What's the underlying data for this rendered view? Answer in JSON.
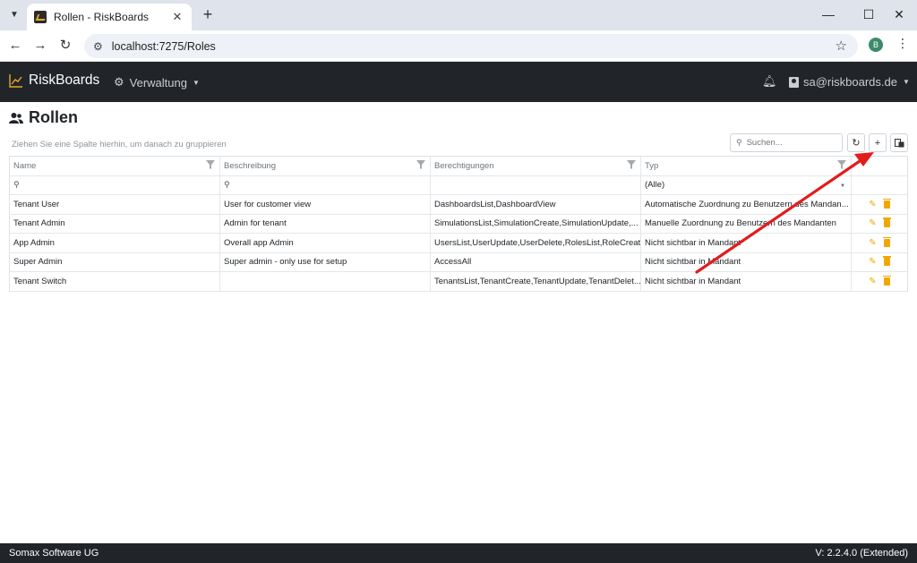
{
  "browser": {
    "tab_title": "Rollen - RiskBoards",
    "url": "localhost:7275/Roles",
    "profile_initial": "B",
    "icons": {
      "menu": "chevron-down-icon",
      "close": "close-icon",
      "new_tab": "plus-icon"
    }
  },
  "navbar": {
    "brand": "RiskBoards",
    "menu_label": "Verwaltung",
    "user_label": "sa@riskboards.de",
    "accent": "#e8a72a"
  },
  "page": {
    "title": "Rollen",
    "group_hint": "Ziehen Sie eine Spalte hierhin, um danach zu gruppieren",
    "search_placeholder": "Suchen..."
  },
  "grid": {
    "columns": [
      "Name",
      "Beschreibung",
      "Berechtigungen",
      "Typ"
    ],
    "type_filter_value": "(Alle)",
    "rows": [
      {
        "name": "Tenant User",
        "description": "User for customer view",
        "permissions": "DashboardsList,DashboardView",
        "type": "Automatische Zuordnung zu Benutzern des Mandan..."
      },
      {
        "name": "Tenant Admin",
        "description": "Admin for tenant",
        "permissions": "SimulationsList,SimulationCreate,SimulationUpdate,...",
        "type": "Manuelle Zuordnung zu Benutzern des Mandanten"
      },
      {
        "name": "App Admin",
        "description": "Overall app Admin",
        "permissions": "UsersList,UserUpdate,UserDelete,RolesList,RoleCreat...",
        "type": "Nicht sichtbar in Mandant"
      },
      {
        "name": "Super Admin",
        "description": "Super admin - only use for setup",
        "permissions": "AccessAll",
        "type": "Nicht sichtbar in Mandant"
      },
      {
        "name": "Tenant Switch",
        "description": "",
        "permissions": "TenantsList,TenantCreate,TenantUpdate,TenantDelet...",
        "type": "Nicht sichtbar in Mandant"
      }
    ],
    "action_color": "#f0a800"
  },
  "annotation": {
    "arrow_color": "#e31c1c"
  },
  "footer": {
    "company": "Somax Software UG",
    "version": "V: 2.2.4.0 (Extended)"
  }
}
